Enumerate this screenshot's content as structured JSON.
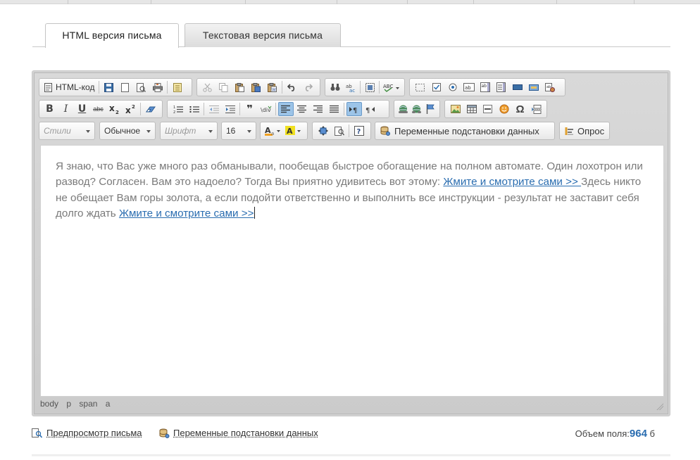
{
  "tabs": {
    "html": "HTML версия письма",
    "text": "Текстовая версия письма"
  },
  "toolbar": {
    "html_code": "HTML-код",
    "styles_placeholder": "Стили",
    "format_value": "Обычное",
    "font_placeholder": "Шрифт",
    "size_value": "16",
    "variables_button": "Переменные подстановки данных",
    "poll_button": "Опрос",
    "bold": "B",
    "italic": "I",
    "underline": "U",
    "strike": "abc",
    "quote": "❞",
    "omega": "Ω"
  },
  "content": {
    "text_1": "Я знаю, что Вас уже много раз обманывали, пообещав быстрое обогащение на полном автомате. Один лохотрон или развод? Согласен. Вам это надоело? Тогда Вы приятно удивитесь вот этому: ",
    "link_1": "Жмите и смотрите сами >> ",
    "text_2": "Здесь никто не обещает Вам горы золота, а если подойти ответственно и выполнить все инструкции - результат не заставит себя долго ждать ",
    "link_2": "Жмите и смотрите сами >>"
  },
  "path": [
    "body",
    "p",
    "span",
    "a"
  ],
  "bottom": {
    "preview": "Предпросмотр письма",
    "variables": "Переменные подстановки данных",
    "volume_label": "Объем поля:",
    "volume_value": "964",
    "volume_unit": "б"
  },
  "colors": {
    "link": "#2a6db0",
    "text": "#7a7a7a",
    "toolbar_bg": "#d3d3d3",
    "active_button": "#9cc4e8"
  }
}
